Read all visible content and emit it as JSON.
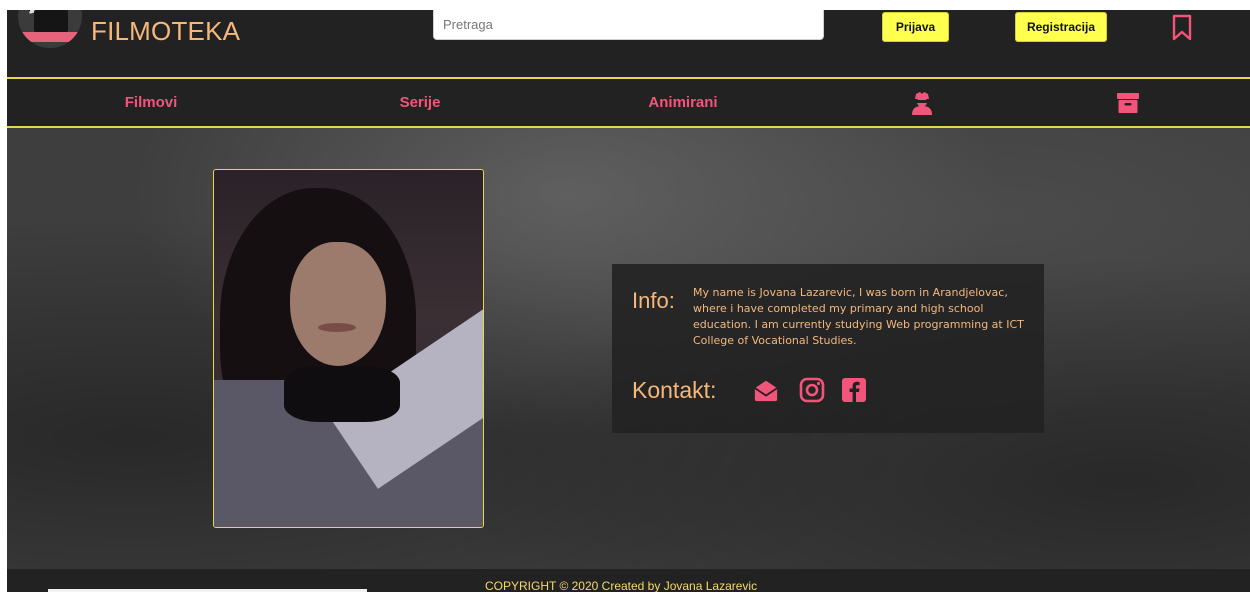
{
  "brand": {
    "name": "FILMOTEKA",
    "logo_icon": "film-clapperboard-icon"
  },
  "search": {
    "placeholder": "Pretraga",
    "value": ""
  },
  "auth": {
    "login_label": "Prijava",
    "register_label": "Registracija"
  },
  "bookmark_icon": "bookmark-icon",
  "nav": {
    "items": [
      {
        "label": "Filmovi"
      },
      {
        "label": "Serije"
      },
      {
        "label": "Animirani"
      },
      {
        "icon": "user-secret-icon"
      },
      {
        "icon": "archive-icon"
      }
    ]
  },
  "profile": {
    "info_label": "Info:",
    "info_text": "My name is Jovana Lazarevic, I was born in Arandjelovac, where i have completed my primary and high school education. I am currently studying Web programming at ICT College of Vocational Studies.",
    "contact_label": "Kontakt:",
    "contacts": [
      {
        "icon": "envelope-open-icon"
      },
      {
        "icon": "instagram-icon"
      },
      {
        "icon": "facebook-icon"
      }
    ]
  },
  "footer": {
    "copyright": "COPYRIGHT © 2020 Created by Jovana Lazarevic"
  },
  "colors": {
    "background": "#222222",
    "accent_yellow": "#e6d64c",
    "button_yellow": "#ffff4d",
    "nav_pink": "#f3547a",
    "text_orange": "#f6b77a"
  }
}
